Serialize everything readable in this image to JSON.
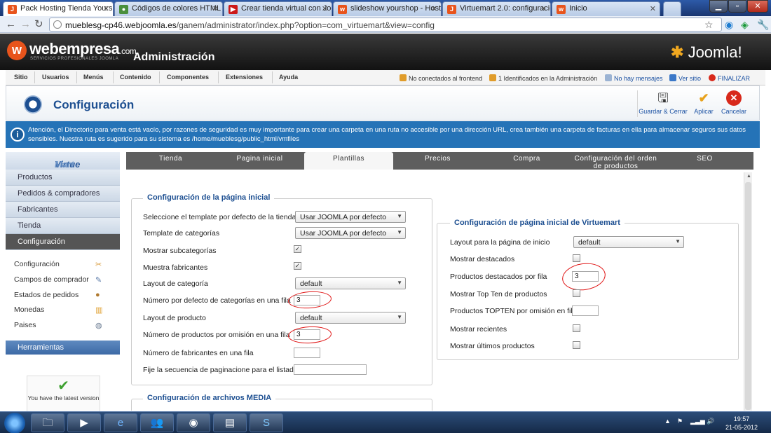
{
  "browser": {
    "tabs": [
      {
        "title": "Pack Hosting Tienda Yoursl",
        "favicon": "joomla-icon",
        "color": "#e8541c",
        "active": true
      },
      {
        "title": "Códigos de colores HTML",
        "favicon": "chrome-icon",
        "color": "#4a8f3c"
      },
      {
        "title": "Crear tienda virtual con Joo",
        "favicon": "youtube-icon",
        "color": "#cc1818"
      },
      {
        "title": "slideshow yourshop - Hosti",
        "favicon": "webempresa-icon",
        "color": "#e8541c"
      },
      {
        "title": "Virtuemart 2.0: configuració",
        "favicon": "joomla-icon",
        "color": "#e8541c"
      },
      {
        "title": "Inicio",
        "favicon": "webempresa-icon",
        "color": "#e8541c"
      }
    ],
    "url_host": "mueblesg-cp46.webjoomla.es",
    "url_path": "/ganem/administrator/index.php?option=com_virtuemart&view=config"
  },
  "header": {
    "brand": "webempresa",
    "brand_suffix": ".com",
    "brand_sub": "SERVICIOS PROFESIONALES JOOMLA",
    "title": "Administración",
    "joomla": "Joomla!"
  },
  "menu": {
    "items": [
      "Sitio",
      "Usuarios",
      "Menús",
      "Contenido",
      "Componentes",
      "Extensiones",
      "Ayuda"
    ],
    "status": {
      "frontend": "No conectados al frontend",
      "admin": "1 Identificados en la Administración",
      "messages": "No hay mensajes",
      "view_site": "Ver sitio",
      "logout": "FINALIZAR"
    }
  },
  "toolbar": {
    "title": "Configuración",
    "save_close": "Guardar & Cerrar",
    "apply": "Aplicar",
    "cancel": "Cancelar"
  },
  "notice": "Atención, el Directorio para venta está vacío, por razones de seguridad es muy importante para crear una carpeta en una ruta no accesible por una dirección URL, crea también una carpeta de facturas en ella para almacenar seguros sus datos sensibles. Nuestra ruta es sugerido para su sistema es /home/mueblesg/public_html/vmfiles",
  "sidebar": {
    "logo_a": "Virtue",
    "logo_b": "Mart",
    "sections": [
      "Productos",
      "Pedidos & compradores",
      "Fabricantes",
      "Tienda",
      "Configuración"
    ],
    "subitems": [
      {
        "label": "Configuración",
        "icon": "wrench-icon"
      },
      {
        "label": "Campos de comprador",
        "icon": "pencil-icon"
      },
      {
        "label": "Estados de pedidos",
        "icon": "paint-icon"
      },
      {
        "label": "Monedas",
        "icon": "coins-icon"
      },
      {
        "label": "Paises",
        "icon": "globe-icon"
      }
    ],
    "tools": "Herramientas",
    "latest": "You have the latest version"
  },
  "tabs": [
    "Tienda",
    "Pagina inicial",
    "Plantillas",
    "Precios",
    "Compra",
    "Configuración del orden de productos",
    "SEO"
  ],
  "left_group": {
    "legend": "Configuración de la página inicial",
    "fields": {
      "template_store": {
        "label": "Seleccione el template por defecto de la tienda",
        "value": "Usar JOOMLA por defecto"
      },
      "template_cat": {
        "label": "Template de categorías",
        "value": "Usar JOOMLA por defecto"
      },
      "show_subcats": {
        "label": "Mostrar subcategorías",
        "checked": true
      },
      "show_manuf": {
        "label": "Muestra fabricantes",
        "checked": true
      },
      "layout_cat": {
        "label": "Layout de categoría",
        "value": "default"
      },
      "cats_per_row": {
        "label": "Número por defecto de categorías en una fila",
        "value": "3"
      },
      "layout_prod": {
        "label": "Layout de producto",
        "value": "default"
      },
      "prods_per_row": {
        "label": "Número de productos por omisión en una fila",
        "value": "3"
      },
      "manuf_per_row": {
        "label": "Número de fabricantes en una fila",
        "value": ""
      },
      "pagination": {
        "label": "Fije la secuencia de paginacione para el listado",
        "value": ""
      }
    }
  },
  "media_group": {
    "legend": "Configuración de archivos MEDIA"
  },
  "right_group": {
    "legend": "Configuración de página inicial de Virtuemart",
    "fields": {
      "home_layout": {
        "label": "Layout para la página de inicio",
        "value": "default"
      },
      "show_featured": {
        "label": "Mostrar destacados",
        "checked": false
      },
      "featured_per_row": {
        "label": "Productos destacados por fila",
        "value": "3"
      },
      "show_topten": {
        "label": "Mostrar Top Ten de productos",
        "checked": false
      },
      "topten_per_row": {
        "label": "Productos TOPTEN por omisión en fila",
        "value": ""
      },
      "show_recent": {
        "label": "Mostrar recientes",
        "checked": false
      },
      "show_latest": {
        "label": "Mostrar últimos productos",
        "checked": false
      }
    }
  },
  "taskbar": {
    "time": "19:57",
    "date": "21-05-2012"
  }
}
